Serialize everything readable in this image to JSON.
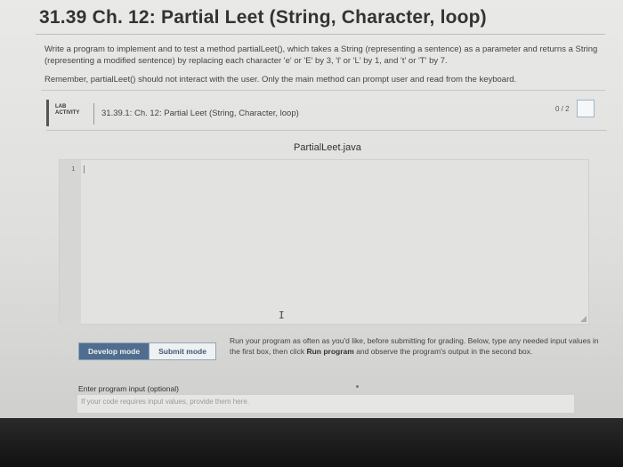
{
  "page": {
    "title": "31.39 Ch. 12: Partial Leet (String, Character, loop)",
    "description": "Write a program to implement and to test a method partialLeet(), which takes a String (representing a sentence) as a parameter and returns a String (representing a modified sentence) by replacing each character 'e' or 'E' by 3, 'l' or 'L' by 1, and 't' or 'T' by 7.",
    "reminder": "Remember, partialLeet() should not interact with the user. Only the main method can prompt user and read from the keyboard."
  },
  "lab": {
    "badge_line1": "LAB",
    "badge_line2": "ACTIVITY",
    "title": "31.39.1: Ch. 12: Partial Leet (String, Character, loop)",
    "score": "0 / 2"
  },
  "editor": {
    "filename": "PartialLeet.java",
    "line_number": "1",
    "content": ""
  },
  "modes": {
    "develop": "Develop mode",
    "submit": "Submit mode"
  },
  "run_info": {
    "text1": "Run your program as often as you'd like, before submitting for grading. Below, type any needed input values in the first box, then click ",
    "bold": "Run program",
    "text2": " and observe the program's output in the second box."
  },
  "input": {
    "label": "Enter program input (optional)",
    "placeholder": "If your code requires input values, provide them here."
  }
}
